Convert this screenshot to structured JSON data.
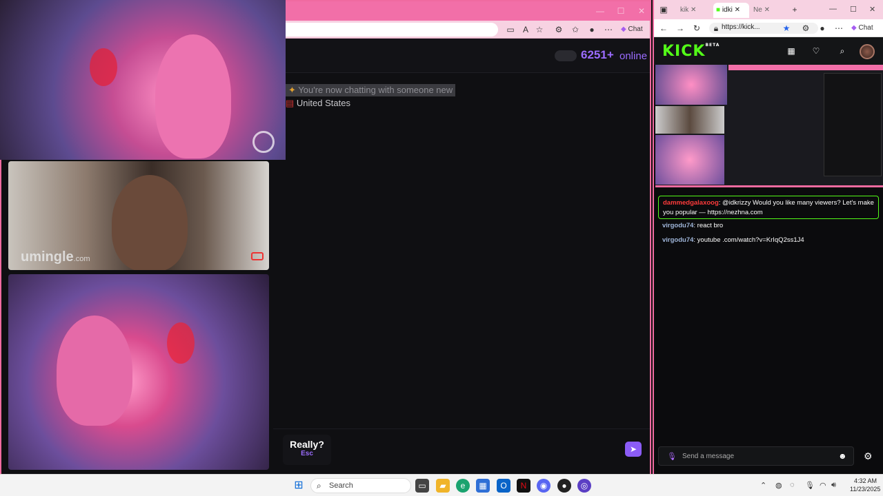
{
  "left_browser": {
    "toolbar": {
      "chat_label": "Chat"
    }
  },
  "umingle": {
    "online_count": "6251",
    "online_plus": "+",
    "online_label": "online",
    "system_message": "You're now chatting with someone new",
    "country": "United States",
    "really_button": "Really?",
    "esc_hint": "Esc",
    "watermark": "umingle",
    "watermark_suffix": ".com"
  },
  "right_browser": {
    "tabs": [
      "kik",
      "idki",
      "Ne"
    ],
    "url": "https://kick...",
    "chat_label": "Chat"
  },
  "kick": {
    "logo": "KICK",
    "logo_badge": "BETA",
    "chat": {
      "pinned": {
        "user": "dammedgalaxoog",
        "text": ": @idkrizzy Would you like many viewers? Let's make you popular — https://nezhna.com"
      },
      "messages": [
        {
          "user": "virgodu74",
          "text": ": react bro"
        },
        {
          "user": "virgodu74",
          "text": ": youtube .com/watch?v=KrIqQ2ss1J4"
        }
      ]
    },
    "composer_placeholder": "Send a message"
  },
  "taskbar": {
    "search_placeholder": "Search",
    "time": "4:32 AM",
    "date": "11/23/2025"
  },
  "colors": {
    "accent_purple": "#9b6cff",
    "kick_green": "#53fc18",
    "pink_frame": "#f06aa0"
  }
}
